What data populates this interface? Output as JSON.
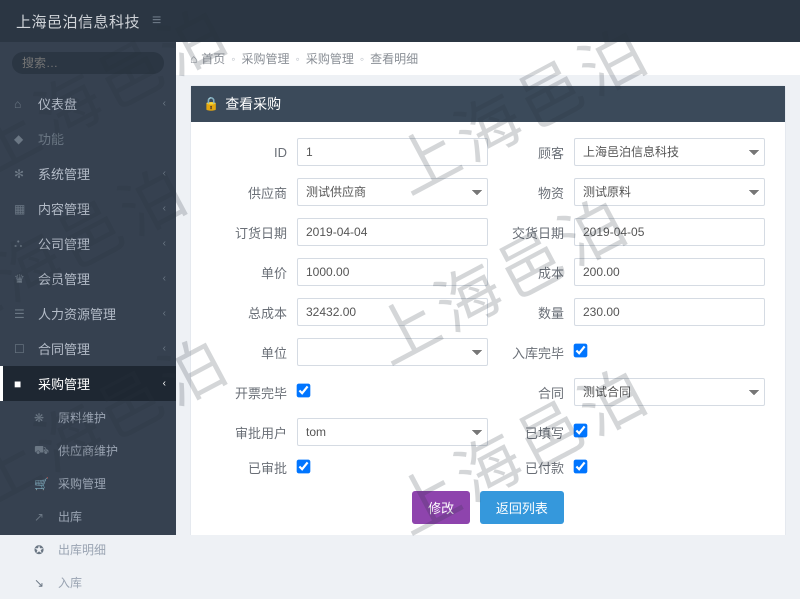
{
  "brand": "上海邑泊信息科技",
  "watermark": "上海邑泊",
  "search": {
    "placeholder": "搜索…"
  },
  "nav": {
    "items": [
      {
        "icon": "⌂",
        "label": "仪表盘",
        "chev": "‹"
      },
      {
        "icon": "◆",
        "label": "功能",
        "chev": "",
        "dim": true
      },
      {
        "icon": "✻",
        "label": "系统管理",
        "chev": "‹"
      },
      {
        "icon": "▦",
        "label": "内容管理",
        "chev": "‹"
      },
      {
        "icon": "⛬",
        "label": "公司管理",
        "chev": "‹"
      },
      {
        "icon": "♛",
        "label": "会员管理",
        "chev": "‹"
      },
      {
        "icon": "☰",
        "label": "人力资源管理",
        "chev": "‹"
      },
      {
        "icon": "☐",
        "label": "合同管理",
        "chev": "‹"
      },
      {
        "icon": "■",
        "label": "采购管理",
        "chev": "‹",
        "active": true
      }
    ],
    "children": [
      {
        "icon": "❋",
        "label": "原料维护"
      },
      {
        "icon": "⛟",
        "label": "供应商维护"
      },
      {
        "icon": "🛒",
        "label": "采购管理"
      },
      {
        "icon": "↗",
        "label": "出库"
      },
      {
        "icon": "✪",
        "label": "出库明细"
      },
      {
        "icon": "↘",
        "label": "入库"
      }
    ]
  },
  "breadcrumb": {
    "home": "首页",
    "items": [
      "采购管理",
      "采购管理",
      "查看明细"
    ]
  },
  "portlet": {
    "title": "查看采购",
    "fields": {
      "id_label": "ID",
      "id_value": "1",
      "customer_label": "顾客",
      "customer_value": "上海邑泊信息科技",
      "supplier_label": "供应商",
      "supplier_value": "测试供应商",
      "material_label": "物资",
      "material_value": "测试原料",
      "orderdate_label": "订货日期",
      "orderdate_value": "2019-04-04",
      "deliverdate_label": "交货日期",
      "deliverdate_value": "2019-04-05",
      "unitprice_label": "单价",
      "unitprice_value": "1000.00",
      "cost_label": "成本",
      "cost_value": "200.00",
      "totalcost_label": "总成本",
      "totalcost_value": "32432.00",
      "qty_label": "数量",
      "qty_value": "230.00",
      "unit_label": "单位",
      "unit_value": "",
      "instock_label": "入库完毕",
      "invoice_label": "开票完毕",
      "contract_label": "合同",
      "contract_value": "测试合同",
      "approver_label": "审批用户",
      "approver_value": "tom",
      "filled_label": "已填写",
      "approved_label": "已审批",
      "paid_label": "已付款"
    },
    "buttons": {
      "edit": "修改",
      "back": "返回列表"
    }
  }
}
